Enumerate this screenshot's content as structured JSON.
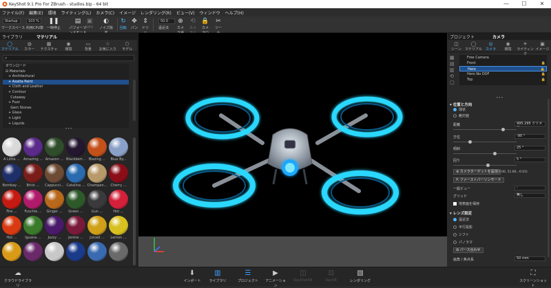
{
  "window": {
    "title": "KeyShot 9.1 Pro For ZBrush - studios.bip - 64 bit",
    "min": "—",
    "max": "☐",
    "close": "✕"
  },
  "menu": [
    "ファイル(F)",
    "編集(E)",
    "環境",
    "ライティング(L)",
    "カメラ(C)",
    "イメージ",
    "レンダリング(R)",
    "ビュー(V)",
    "ウィンドウ",
    "ヘルプ(H)"
  ],
  "toolbar": {
    "workspace_value": "Startup",
    "workspace_label": "ワークスペース",
    "cpu_value": "103 %",
    "cpu_label": "利用CPU数",
    "pause_label": "一時停止",
    "perf_label": "パフォーマンスモード",
    "gpu_label": "GPU",
    "denoise_label": "ノイズ除去",
    "tumble_label": "回転",
    "pan_label": "パン",
    "dolly_label": "ドリー",
    "fov_value": "50.0",
    "perspective_label": "遠近法",
    "add_camera_label": "カメラ追加",
    "reset_camera_label": "カメラリセット",
    "lock_camera_label": "カメラロック",
    "tools_label": "ツール"
  },
  "left_panel": {
    "header_tabs": [
      "ライブラリ",
      "マテリアル"
    ],
    "tabs": [
      {
        "label": "マテリアル",
        "icon": "sphere-icon"
      },
      {
        "label": "カラー",
        "icon": "palette-icon"
      },
      {
        "label": "テクスチャ",
        "icon": "texture-icon"
      },
      {
        "label": "環境",
        "icon": "environment-icon"
      },
      {
        "label": "背景",
        "icon": "background-icon"
      },
      {
        "label": "お気に入り",
        "icon": "star-icon"
      },
      {
        "label": "モデル",
        "icon": "model-icon"
      }
    ],
    "search_placeholder": "",
    "tree": [
      "ダウンロード",
      "Materials",
      "Architectural",
      "Axalta Paint",
      "Cloth and Leather",
      "Contour",
      "Cutaway",
      "Fuzz",
      "Gem Stones",
      "Glass",
      "Light",
      "Liquids"
    ],
    "swatches": [
      {
        "label": "A Little ...",
        "color": "#d9d9d9"
      },
      {
        "label": "Amazing ...",
        "color": "#5b2a8a"
      },
      {
        "label": "Amazon ...",
        "color": "#2f4d2a"
      },
      {
        "label": "Blackberr...",
        "color": "#23162e"
      },
      {
        "label": "Blazing ...",
        "color": "#c4501a"
      },
      {
        "label": "Blue By...",
        "color": "#8aa0c8"
      },
      {
        "label": "Bombay ...",
        "color": "#1f2f6a"
      },
      {
        "label": "Brick ...",
        "color": "#7a1d1a"
      },
      {
        "label": "Cappucci...",
        "color": "#6e4b34"
      },
      {
        "label": "Catalina ...",
        "color": "#2a6bb0"
      },
      {
        "label": "Champan...",
        "color": "#b89a6a"
      },
      {
        "label": "Cherry ...",
        "color": "#8a0d18"
      },
      {
        "label": "Fire ...",
        "color": "#c41a12"
      },
      {
        "label": "Fuschia ...",
        "color": "#b01a6a"
      },
      {
        "label": "Ginger ...",
        "color": "#b8681a"
      },
      {
        "label": "Green ...",
        "color": "#2e5a2a"
      },
      {
        "label": "Gun ...",
        "color": "#3a3a3c"
      },
      {
        "label": "Hot ...",
        "color": "#d4203a"
      },
      {
        "label": "Hot ...",
        "color": "#d93a12"
      },
      {
        "label": "Iguana ...",
        "color": "#3a7a2a"
      },
      {
        "label": "Jazzy ...",
        "color": "#4a1a6a"
      },
      {
        "label": "Jenine ...",
        "color": "#7a1a3a"
      },
      {
        "label": "Juiced ...",
        "color": "#d0a018"
      },
      {
        "label": "Lemon ...",
        "color": "#d8c020"
      },
      {
        "label": "",
        "color": "#d99a18"
      },
      {
        "label": "",
        "color": "#6a2a6a"
      },
      {
        "label": "",
        "color": "#c8c8c8"
      },
      {
        "label": "",
        "color": "#1a3a8a"
      },
      {
        "label": "",
        "color": "#3a6ab0"
      },
      {
        "label": "",
        "color": "#6a6a6a"
      }
    ]
  },
  "right_panel": {
    "header_tabs": [
      "プロジェクト",
      "カメラ"
    ],
    "tabs": [
      {
        "label": "シーン",
        "icon": "scene-icon"
      },
      {
        "label": "マテリアル",
        "icon": "sphere-icon"
      },
      {
        "label": "カメラ",
        "icon": "camera-icon"
      },
      {
        "label": "環境",
        "icon": "environment-icon"
      },
      {
        "label": "ライティング",
        "icon": "light-icon"
      },
      {
        "label": "イメージ",
        "icon": "image-icon"
      }
    ],
    "cameras": [
      "Free Camera",
      "Front",
      "Hero",
      "Hero No DOF",
      "Top"
    ],
    "position_section": "位置と方向",
    "orbit_label": "球状",
    "walk_label": "絶対値",
    "distance_label": "距離",
    "distance_value": "995.295 ミリメー",
    "azimuth_label": "方位",
    "azimuth_value": "-90 °",
    "inclination_label": "傾斜",
    "inclination_value": "25 °",
    "twist_label": "回り",
    "twist_value": "5 °",
    "set_target_label": "カメラターゲットを設定",
    "target_coords": "(0.00, 51.60, -0.03)",
    "first_person_label": "ファーストパーソンモード",
    "standard_view_label": "一般ビュー",
    "standard_view_value": "-",
    "grid_label": "グリッド",
    "grid_value": "無し",
    "ground_label": "地表面を保持",
    "lens_section": "レンズ設定",
    "perspective_label": "遠近法",
    "orthographic_label": "平行投影",
    "shift_label": "シフト",
    "panorama_label": "パノラマ",
    "pers_match_label": "パース合わせ",
    "focal_label": "画角 / 焦点長",
    "focal_value": "50 mm"
  },
  "bottom": {
    "cloud_label": "クラウドライブラリ",
    "import_label": "インポート",
    "library_label": "ライブラリ",
    "project_label": "プロジェクト",
    "animation_label": "アニメーション",
    "keyshotxr_label": "KeyShotXR",
    "keyvr_label": "KeyVR",
    "render_label": "レンダリング",
    "screenshot_label": "スクリーンショット"
  },
  "colors": {
    "accent": "#3aa0ff",
    "selection": "#1f4f8c",
    "glow": "#2ad8ff"
  }
}
